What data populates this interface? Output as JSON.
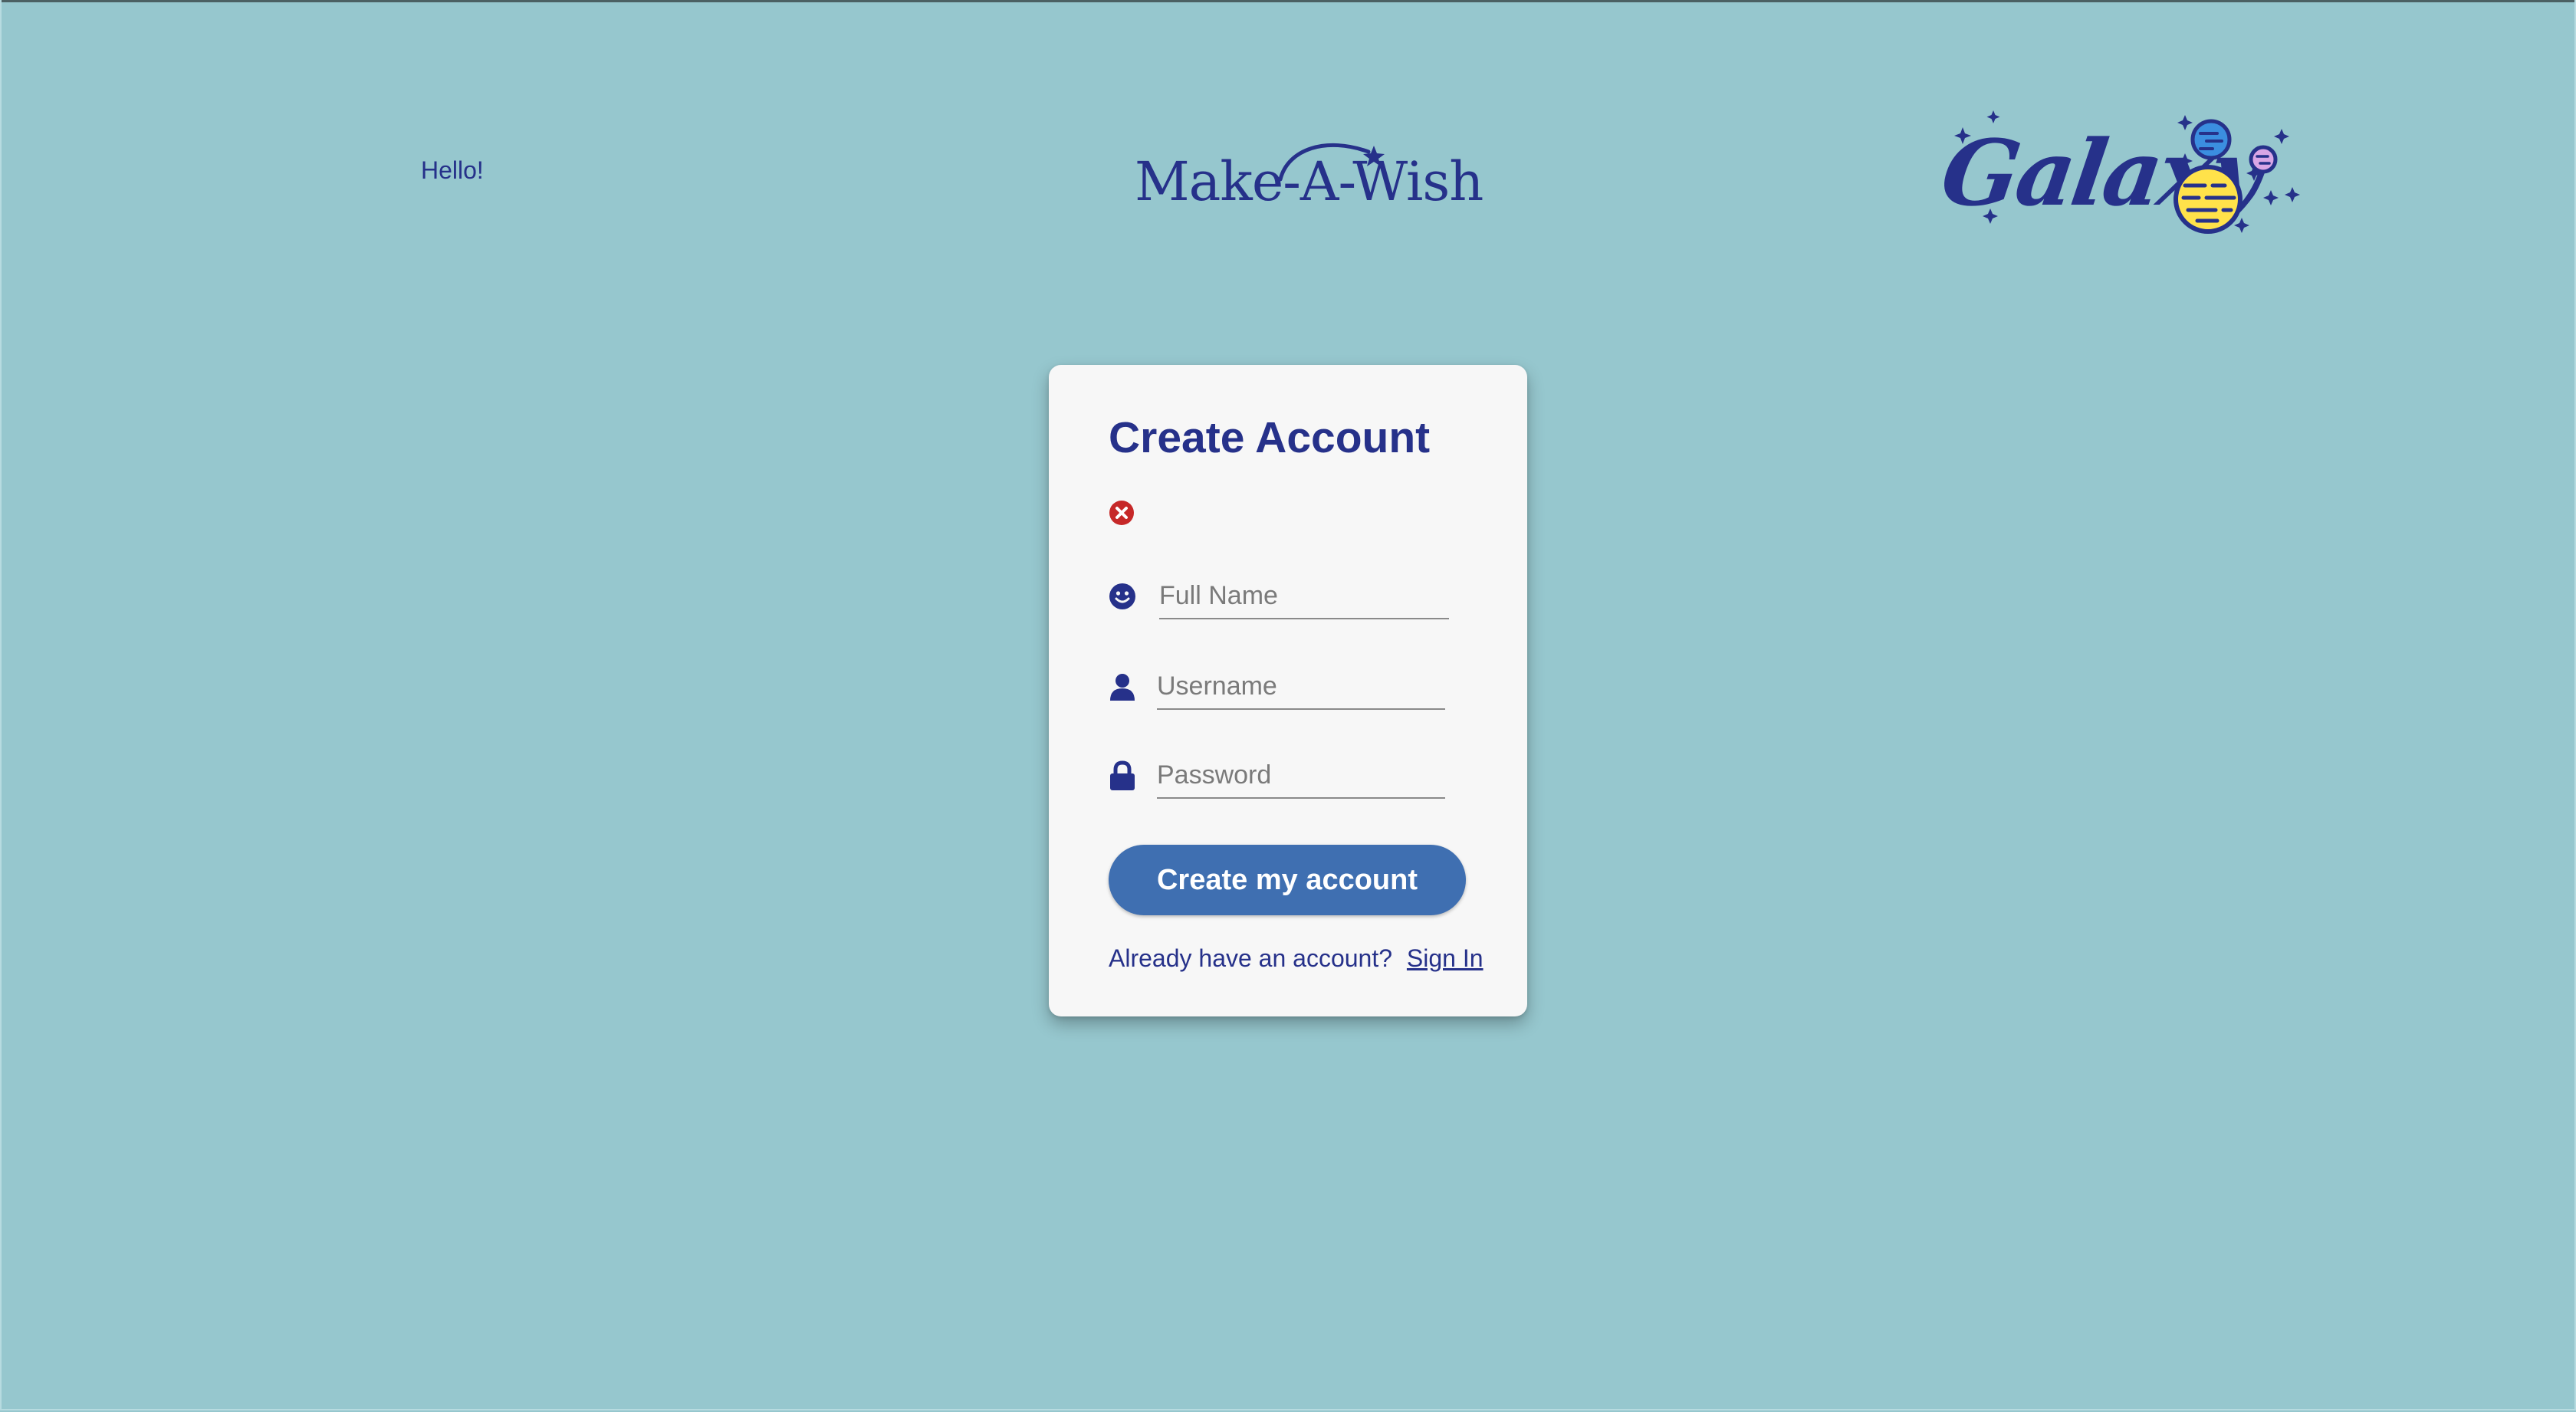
{
  "header": {
    "greeting": "Hello!",
    "center_logo_text": "Make-A-Wish",
    "right_logo_text": "Galaxy"
  },
  "card": {
    "title": "Create Account",
    "error_icon": "close-circle-icon",
    "fields": {
      "full_name": {
        "placeholder": "Full Name",
        "value": "",
        "icon": "smiley-icon"
      },
      "username": {
        "placeholder": "Username",
        "value": "",
        "icon": "user-icon"
      },
      "password": {
        "placeholder": "Password",
        "value": "",
        "icon": "lock-icon"
      }
    },
    "submit_label": "Create my account",
    "signin_prompt": "Already have an account?",
    "signin_link": "Sign In"
  },
  "colors": {
    "background": "#96c7ce",
    "primary_text": "#26318a",
    "button": "#3f6fb1",
    "card": "#f7f7f7",
    "error": "#c62828",
    "planet_blue": "#3b8ee0",
    "planet_yellow": "#ffe24a",
    "planet_pink": "#d9a6e6"
  }
}
